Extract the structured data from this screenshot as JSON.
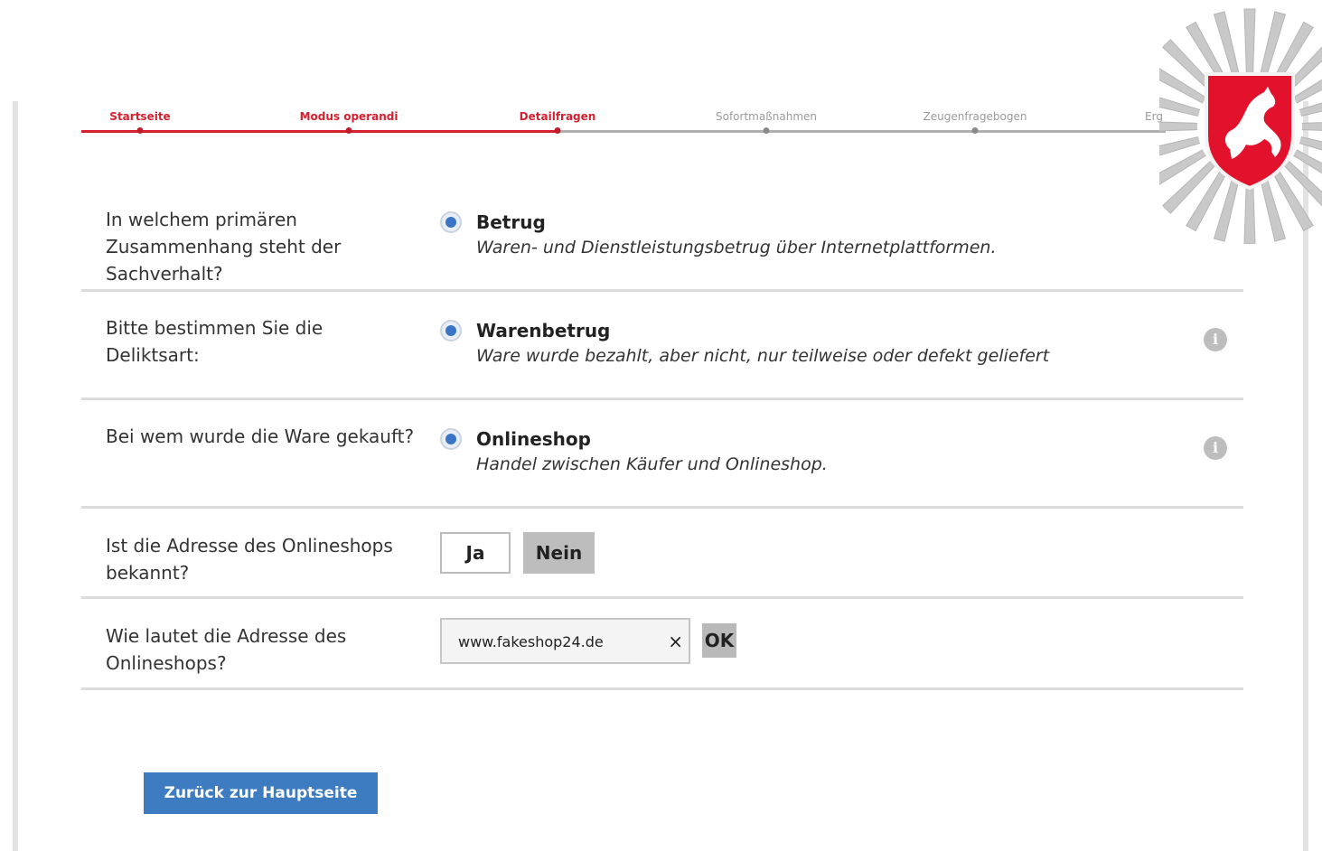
{
  "progress": {
    "steps": [
      {
        "label": "Startseite",
        "state": "done"
      },
      {
        "label": "Modus operandi",
        "state": "done"
      },
      {
        "label": "Detailfragen",
        "state": "current"
      },
      {
        "label": "Sofortmaßnahmen",
        "state": "todo"
      },
      {
        "label": "Zeugenfragebogen",
        "state": "todo"
      },
      {
        "label": "Erg",
        "state": "todo"
      }
    ]
  },
  "questions": {
    "q1": {
      "text": "In welchem primären Zusammenhang steht der Sachverhalt?",
      "answer_title": "Betrug",
      "answer_desc": "Waren- und Dienstleistungsbetrug über Internetplattformen."
    },
    "q2": {
      "text": "Bitte bestimmen Sie die Deliktsart:",
      "answer_title": "Warenbetrug",
      "answer_desc": "Ware wurde bezahlt, aber nicht, nur teilweise oder defekt geliefert"
    },
    "q3": {
      "text": "Bei wem wurde die Ware gekauft?",
      "answer_title": "Onlineshop",
      "answer_desc": "Handel zwischen Käufer und Onlineshop."
    },
    "q4": {
      "text": "Ist die Adresse des Onlineshops bekannt?",
      "yes_label": "Ja",
      "no_label": "Nein",
      "selected": "Nein"
    },
    "q5": {
      "text": "Wie lautet die Adresse des Onlineshops?",
      "input_value": "www.fakeshop24.de",
      "clear_glyph": "×",
      "ok_label": "OK"
    }
  },
  "info_icon_glyph": "i",
  "back_button_label": "Zurück zur Hauptseite",
  "colors": {
    "accent_red": "#d4202f",
    "accent_blue": "#3d7cc1",
    "inactive_gray": "#b0b0b0"
  }
}
